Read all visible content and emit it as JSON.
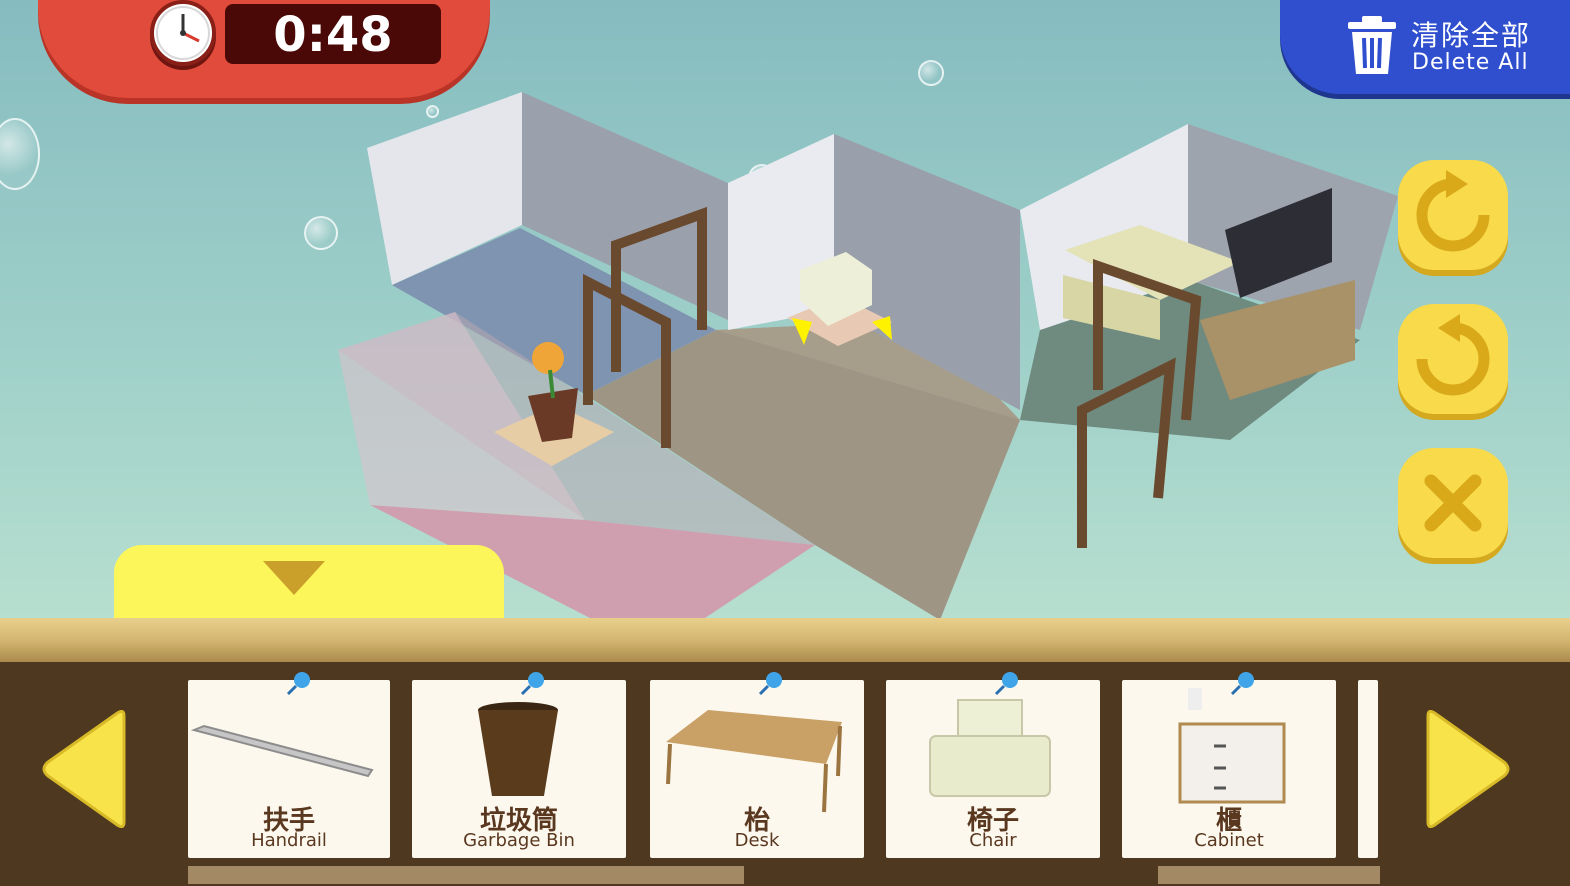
{
  "timer": {
    "value": "0:48",
    "icon": "clock-icon"
  },
  "toolbar": {
    "delete_all_cn": "清除全部",
    "delete_all_en": "Delete All",
    "delete_icon": "trash-icon",
    "rotate_right_icon": "rotate-clockwise-icon",
    "rotate_left_icon": "rotate-counterclockwise-icon",
    "close_icon": "close-icon"
  },
  "tray": {
    "collapse_icon": "triangle-down-icon",
    "prev_icon": "arrow-left-icon",
    "next_icon": "arrow-right-icon",
    "items": [
      {
        "cn": "扶手",
        "en": "Handrail",
        "icon": "handrail-icon"
      },
      {
        "cn": "垃圾筒",
        "en": "Garbage Bin",
        "icon": "garbage-bin-icon"
      },
      {
        "cn": "枱",
        "en": "Desk",
        "icon": "desk-icon"
      },
      {
        "cn": "椅子",
        "en": "Chair",
        "icon": "chair-icon"
      },
      {
        "cn": "櫃",
        "en": "Cabinet",
        "icon": "cabinet-icon"
      }
    ]
  },
  "colors": {
    "timer_panel": "#e04b3b",
    "delete_button": "#2f4fcf",
    "action_button": "#f8da4a",
    "tray_bg": "#4e3920"
  }
}
